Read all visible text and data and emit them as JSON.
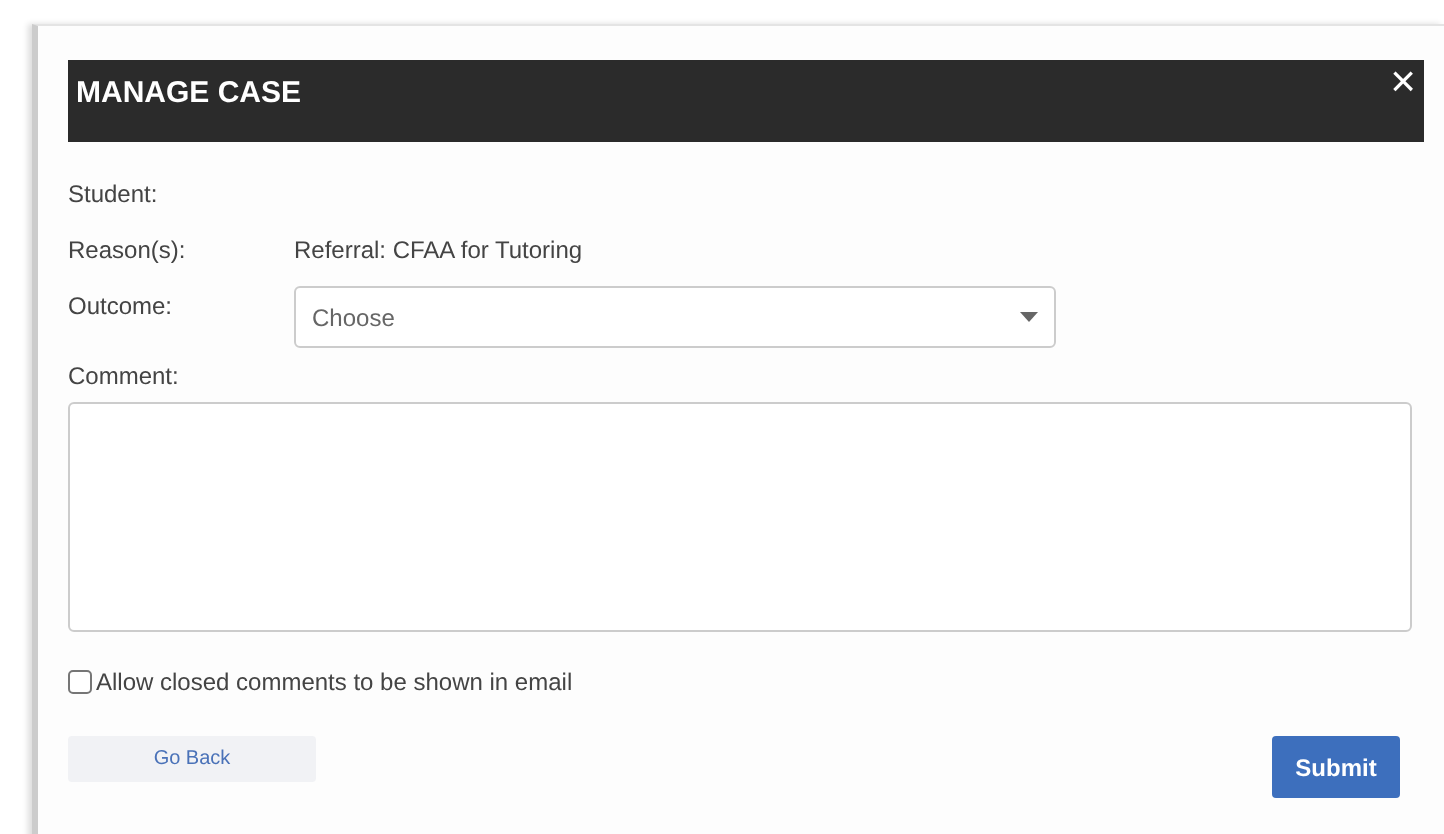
{
  "dialog": {
    "title": "MANAGE CASE",
    "close": "×"
  },
  "fields": [
    {
      "label": "Student:"
    },
    {
      "label": "Reason(s):",
      "value": "Referral: CFAA for Tutoring"
    }
  ],
  "outcome": {
    "label": "Outcome:",
    "placeholder": "Choose"
  },
  "comment": {
    "label": "Comment:"
  },
  "allow_email": {
    "label": "Allow closed comments to be shown in email",
    "checked": false
  },
  "buttons": {
    "back": "Go Back",
    "submit": "Submit"
  }
}
